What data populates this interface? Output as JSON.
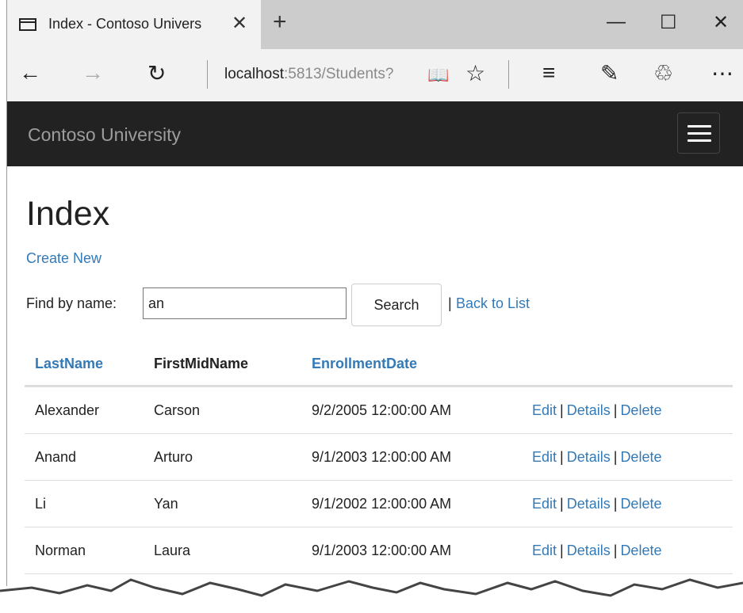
{
  "browser": {
    "tab_title": "Index - Contoso Univers",
    "tab_close": "✕",
    "new_tab": "+",
    "minimize": "—",
    "maximize": "☐",
    "close": "✕",
    "back": "←",
    "forward": "→",
    "refresh": "↻",
    "url_host": "localhost",
    "url_rest": ":5813/Students?",
    "reading_view": "📖",
    "favorite": "☆",
    "hub": "≡",
    "notes": "✎",
    "share": "♲",
    "more": "⋯"
  },
  "site": {
    "brand": "Contoso University"
  },
  "page": {
    "title": "Index",
    "create_new": "Create New",
    "find_label": "Find by name:",
    "search_value": "an",
    "search_button": "Search",
    "pipe": "|",
    "back_to_list": "Back to List"
  },
  "table": {
    "headers": {
      "last_name": "LastName",
      "first_mid_name": "FirstMidName",
      "enrollment_date": "EnrollmentDate"
    },
    "rows": [
      {
        "last": "Alexander",
        "first": "Carson",
        "date": "9/2/2005 12:00:00 AM"
      },
      {
        "last": "Anand",
        "first": "Arturo",
        "date": "9/1/2003 12:00:00 AM"
      },
      {
        "last": "Li",
        "first": "Yan",
        "date": "9/1/2002 12:00:00 AM"
      },
      {
        "last": "Norman",
        "first": "Laura",
        "date": "9/1/2003 12:00:00 AM"
      }
    ],
    "actions": {
      "edit": "Edit",
      "details": "Details",
      "delete": "Delete",
      "sep": "|"
    }
  },
  "colors": {
    "link": "#337ab7",
    "header_bg": "#222222",
    "tabbar_bg": "#cccccc"
  }
}
